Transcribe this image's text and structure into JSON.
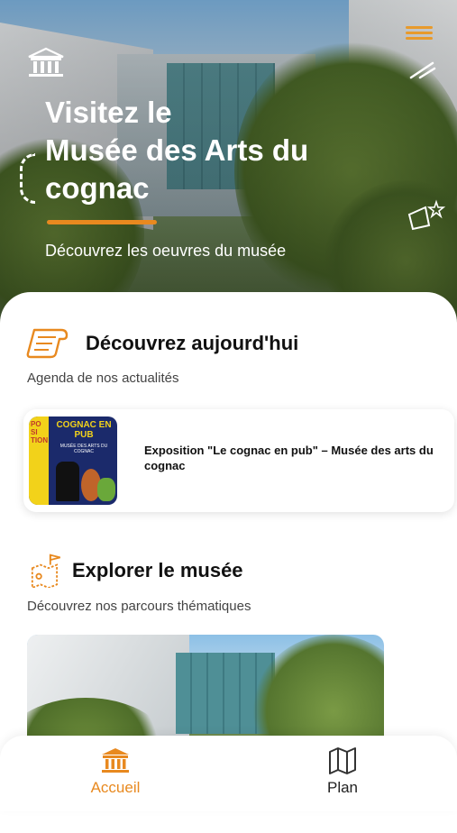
{
  "hero": {
    "title_lines": [
      "Visitez le",
      "Musée des Arts du",
      "cognac"
    ],
    "subtitle": "Découvrez les oeuvres du musée"
  },
  "colors": {
    "accent": "#e8891f",
    "text": "#111111",
    "muted": "#444444"
  },
  "today": {
    "title": "Découvrez aujourd'hui",
    "subtitle": "Agenda de nos actualités",
    "events": [
      {
        "title": "Exposition \"Le cognac en pub\" – Musée des arts du cognac",
        "poster": {
          "headline": "COGNAC EN PUB",
          "side_text": "PO SI TION",
          "museum": "MUSÉE DES ARTS DU COGNAC"
        }
      }
    ]
  },
  "explore": {
    "title": "Explorer le musée",
    "subtitle": "Découvrez nos parcours thématiques"
  },
  "tabbar": {
    "items": [
      {
        "label": "Accueil",
        "icon": "museum-icon",
        "active": true
      },
      {
        "label": "Plan",
        "icon": "map-icon",
        "active": false
      }
    ]
  }
}
